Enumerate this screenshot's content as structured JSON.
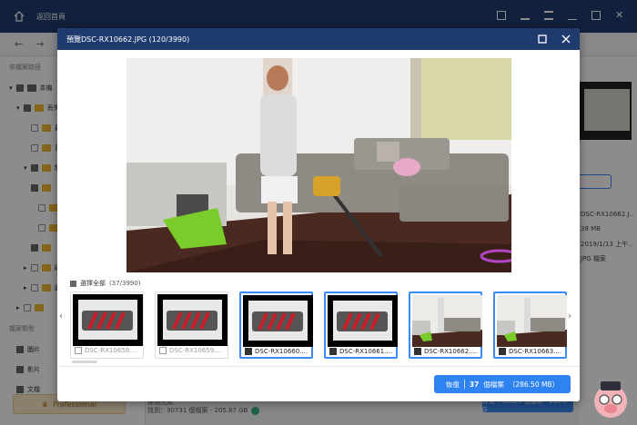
{
  "app": {
    "title": "返回首頁",
    "sidebar_section1": "依檔案路徑",
    "sidebar_section2": "檔案類型",
    "tree": [
      "本機",
      "丟失",
      "最",
      "目",
      "現",
      "磁",
      "邊"
    ],
    "types": [
      "圖片",
      "影片",
      "文檔"
    ],
    "pro_label": "Professional",
    "right_info": [
      "DSC-RX10662.J..",
      "38 MB",
      "2019/1/13 上午..",
      "JPG 檔案"
    ],
    "bottom_line1": "掃描完成",
    "bottom_line2": "找到：30731 個檔案 - 205.87 GB",
    "bottom_recover": "恢復｜30525 個檔案 - 205.8 G"
  },
  "modal": {
    "title": "預覽DSC-RX10662.JPG  (120/3990)",
    "select_all_label": "選擇全部",
    "select_all_count": "(37/3990)",
    "thumbnails": [
      {
        "label": "DSC-RX10658....",
        "selected": false,
        "kind": "roller"
      },
      {
        "label": "DSC-RX10659....",
        "selected": false,
        "kind": "roller"
      },
      {
        "label": "DSC-RX10660....",
        "selected": true,
        "kind": "roller"
      },
      {
        "label": "DSC-RX10661....",
        "selected": true,
        "kind": "roller"
      },
      {
        "label": "DSC-RX10662....",
        "selected": true,
        "kind": "room"
      },
      {
        "label": "DSC-RX10663....",
        "selected": true,
        "kind": "room"
      }
    ],
    "recover_prefix": "恢復",
    "recover_count": "37",
    "recover_unit": "個檔案",
    "recover_size": "（286.50 MB）"
  },
  "colors": {
    "header": "#1f3b6e",
    "accent": "#2f83f0",
    "roller_red": "#c81e2a"
  },
  "icons": [
    "home-icon",
    "maximize-icon",
    "close-icon",
    "chevron-left-icon",
    "chevron-right-icon"
  ]
}
